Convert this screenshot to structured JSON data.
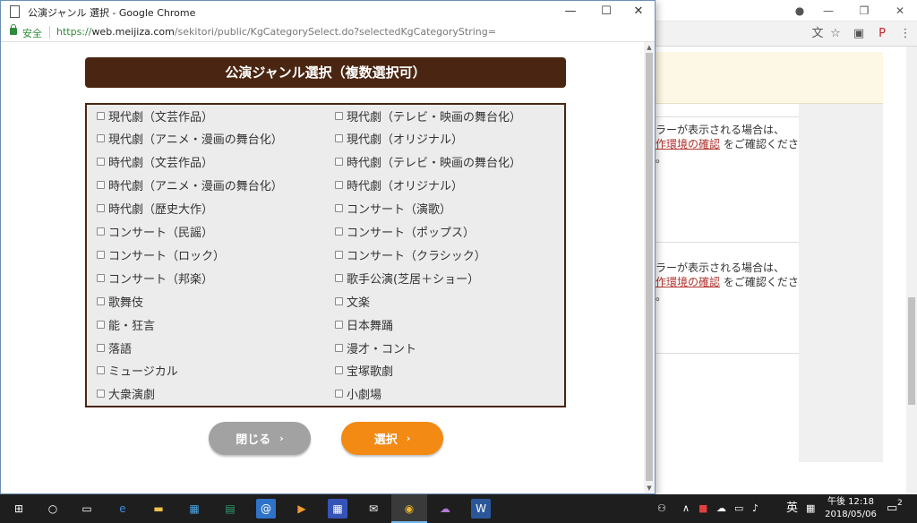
{
  "popup": {
    "title": "公演ジャンル 選択 - Google Chrome",
    "secure_label": "安全",
    "url_scheme": "https://",
    "url_host": "web.meijiza.com",
    "url_path": "/sekitori/public/KgCategorySelect.do?selectedKgCategoryString=",
    "minimize": "—",
    "maximize": "☐",
    "close": "✕"
  },
  "modal": {
    "heading": "公演ジャンル選択（複数選択可）",
    "genres_left": [
      "現代劇（文芸作品）",
      "現代劇（アニメ・漫画の舞台化）",
      "時代劇（文芸作品）",
      "時代劇（アニメ・漫画の舞台化）",
      "時代劇（歴史大作）",
      "コンサート（民謡）",
      "コンサート（ロック）",
      "コンサート（邦楽）",
      "歌舞伎",
      "能・狂言",
      "落語",
      "ミュージカル",
      "大衆演劇"
    ],
    "genres_right": [
      "現代劇（テレビ・映画の舞台化）",
      "現代劇（オリジナル）",
      "時代劇（テレビ・映画の舞台化）",
      "時代劇（オリジナル）",
      "コンサート（演歌）",
      "コンサート（ポップス）",
      "コンサート（クラシック）",
      "歌手公演(芝居＋ショー）",
      "文楽",
      "日本舞踊",
      "漫才・コント",
      "宝塚歌劇",
      "小劇場"
    ],
    "close_button": "閉じる",
    "select_button": "選択",
    "chevron": "›"
  },
  "background": {
    "notice_1_line1": "ラーが表示される場合は、",
    "notice_1_link": "作環境の確認",
    "notice_1_line2": "をご確認くださ",
    "notice_1_line3": "。",
    "notice_2_line1": "ラーが表示される場合は、",
    "notice_2_link": "作環境の確認",
    "notice_2_line2": "をご確認くださ",
    "notice_2_line3": "。"
  },
  "taskbar": {
    "ime_label": "英",
    "time": "午後 12:18",
    "date": "2018/05/06",
    "notification_count": "2"
  },
  "colors": {
    "header_brown": "#4a2612",
    "select_orange": "#f28a14",
    "close_gray": "#a2a2a2",
    "secure_green": "#2e8b3c"
  }
}
